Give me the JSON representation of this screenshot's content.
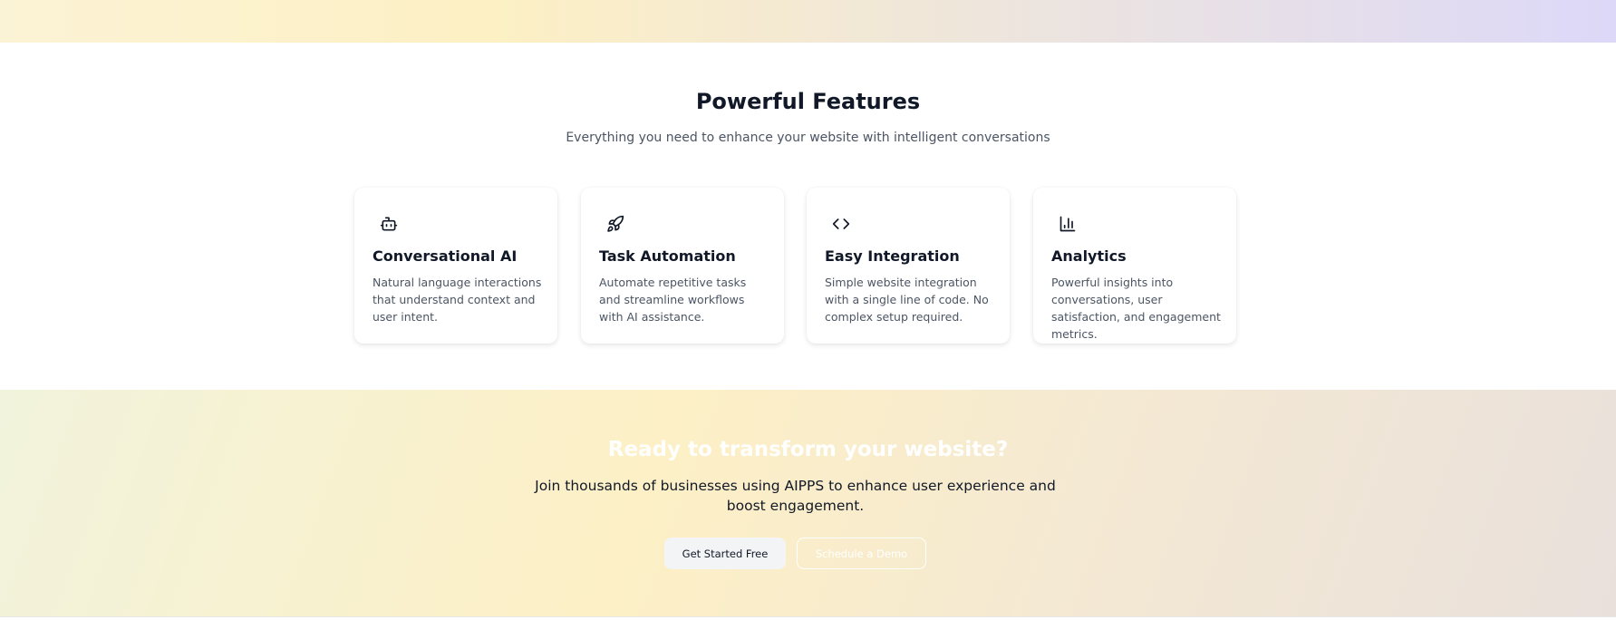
{
  "features": {
    "title": "Powerful Features",
    "subtitle": "Everything you need to enhance your website with intelligent conversations",
    "cards": [
      {
        "icon": "bot-icon",
        "title": "Conversational AI",
        "description": "Natural language interactions that understand context and user intent."
      },
      {
        "icon": "rocket-icon",
        "title": "Task Automation",
        "description": "Automate repetitive tasks and streamline workflows with AI assistance."
      },
      {
        "icon": "code-icon",
        "title": "Easy Integration",
        "description": "Simple website integration with a single line of code. No complex setup required."
      },
      {
        "icon": "bar-chart-icon",
        "title": "Analytics",
        "description": "Powerful insights into conversations, user satisfaction, and engagement metrics."
      }
    ]
  },
  "cta": {
    "title": "Ready to transform your website?",
    "subtitle": "Join thousands of businesses using AIPPS to enhance user experience and boost engagement.",
    "primary_button": "Get Started Free",
    "secondary_button": "Schedule a Demo"
  },
  "colors": {
    "heading": "#111827",
    "body_text": "#4b5563",
    "cta_title": "#ffffff",
    "primary_button_bg": "#f3f4f6"
  }
}
